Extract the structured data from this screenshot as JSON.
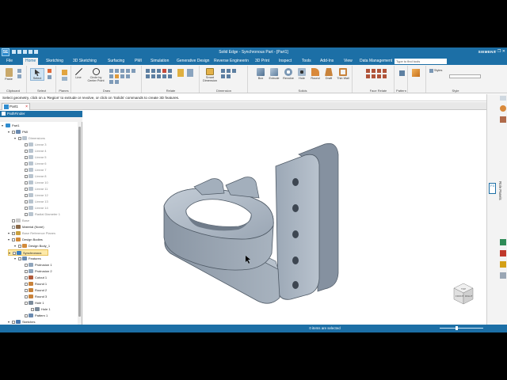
{
  "window": {
    "title": "Solid Edge - Synchronous Part - [Part1]",
    "logo": "SE",
    "brand": "SIEMENS",
    "controls": "–  ❐  ✕"
  },
  "menu": {
    "tabs": [
      "File",
      "Home",
      "Sketching",
      "3D Sketching",
      "Surfacing",
      "PMI",
      "Simulation",
      "Generative Design",
      "Reverse Engineerin",
      "3D Print",
      "Inspect",
      "Tools",
      "Add-Ins",
      "View",
      "Data Management"
    ],
    "active_tab": "Home",
    "search_placeholder": "Type to find tools"
  },
  "ribbon": {
    "groups": [
      "Clipboard",
      "Select",
      "Planes",
      "Draw",
      "Relate",
      "Dimension",
      "Solids",
      "Face Relate",
      "Pattern",
      "Style"
    ],
    "buttons": {
      "paste": "Paste",
      "select": "Select",
      "line": "Line",
      "circle": "Circle by Center Point",
      "smart_dimension": "Smart Dimension",
      "box": "Box",
      "extrude": "Extrude",
      "revolve": "Revolve",
      "hole": "Hole",
      "round": "Round",
      "draft": "Draft",
      "thin_wall": "Thin Wall",
      "styles": "Styles"
    }
  },
  "prompt": "Select geometry, click on a 'Region' to extrude or revolve, or click on 'Solids' commands to create 3D features.",
  "document_tab": "Part1",
  "pathfinder": {
    "title": "PathFinder",
    "tree": [
      {
        "label": "Part1",
        "level": 0,
        "icon": "part"
      },
      {
        "label": "PMI",
        "level": 1,
        "icon": "pmi"
      },
      {
        "label": "Dimensions",
        "level": 2,
        "icon": "dim",
        "grey": true
      },
      {
        "label": "Linear 3",
        "level": 3,
        "icon": "dim",
        "grey": true
      },
      {
        "label": "Linear 4",
        "level": 3,
        "icon": "dim",
        "grey": true
      },
      {
        "label": "Linear 5",
        "level": 3,
        "icon": "dim",
        "grey": true
      },
      {
        "label": "Linear 6",
        "level": 3,
        "icon": "dim",
        "grey": true
      },
      {
        "label": "Linear 7",
        "level": 3,
        "icon": "dim",
        "grey": true
      },
      {
        "label": "Linear 8",
        "level": 3,
        "icon": "dim",
        "grey": true
      },
      {
        "label": "Linear 10",
        "level": 3,
        "icon": "dim",
        "grey": true
      },
      {
        "label": "Linear 11",
        "level": 3,
        "icon": "dim",
        "grey": true
      },
      {
        "label": "Linear 12",
        "level": 3,
        "icon": "dim",
        "grey": true
      },
      {
        "label": "Linear 13",
        "level": 3,
        "icon": "dim",
        "grey": true
      },
      {
        "label": "Linear 14",
        "level": 3,
        "icon": "dim",
        "grey": true
      },
      {
        "label": "Radial Diameter 1",
        "level": 3,
        "icon": "dim",
        "grey": true
      },
      {
        "label": "Base",
        "level": 1,
        "icon": "base",
        "grey": true
      },
      {
        "label": "Material (None)",
        "level": 1,
        "icon": "material"
      },
      {
        "label": "Base Reference Planes",
        "level": 1,
        "icon": "planes",
        "grey": true
      },
      {
        "label": "Design Bodies",
        "level": 1,
        "icon": "body"
      },
      {
        "label": "Design Body_1",
        "level": 2,
        "icon": "body"
      },
      {
        "label": "Synchronous",
        "level": 1,
        "icon": "sync",
        "selected": true
      },
      {
        "label": "Features",
        "level": 2,
        "icon": "features"
      },
      {
        "label": "Protrusion 1",
        "level": 3,
        "icon": "feature"
      },
      {
        "label": "Protrusion 2",
        "level": 3,
        "icon": "feature"
      },
      {
        "label": "Cutout 1",
        "level": 3,
        "icon": "cutout"
      },
      {
        "label": "Round 1",
        "level": 3,
        "icon": "round"
      },
      {
        "label": "Round 2",
        "level": 3,
        "icon": "round"
      },
      {
        "label": "Round 3",
        "level": 3,
        "icon": "round"
      },
      {
        "label": "Hole 1",
        "level": 3,
        "icon": "hole"
      },
      {
        "label": "Hole 1",
        "level": 4,
        "icon": "hole"
      },
      {
        "label": "Pattern 1",
        "level": 3,
        "icon": "pattern"
      },
      {
        "label": "Sketches",
        "level": 1,
        "icon": "sketch"
      }
    ]
  },
  "right_panel": {
    "label": "Role Panels",
    "key_tip": "F3"
  },
  "view_cube": {
    "labels": [
      "FRONT",
      "RIGHT",
      "TOP"
    ]
  },
  "status": {
    "text": "0 items are selected"
  },
  "colors": {
    "accent": "#1c6fa6",
    "part_face": "#a9b4c1",
    "part_dark": "#6f7b89"
  }
}
